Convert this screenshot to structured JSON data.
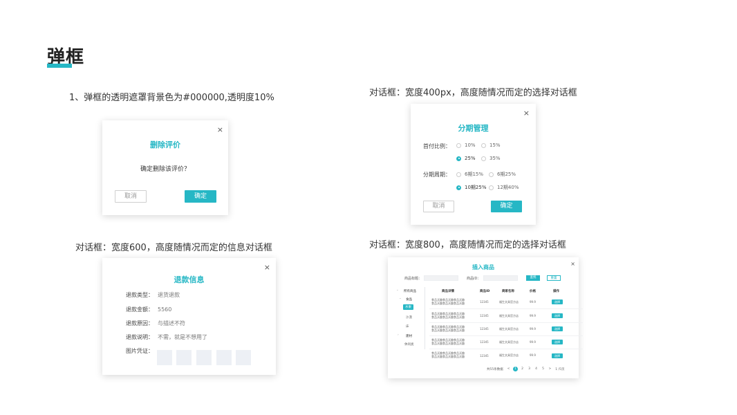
{
  "page": {
    "title": "弹框",
    "accent_color": "#26b7c5"
  },
  "captions": {
    "c1": "1、弹框的透明遮罩背景色为#000000,透明度10%",
    "c2": "对话框：宽度400px，高度随情况而定的选择对话框",
    "c3": "对话框：宽度600，高度随情况而定的信息对话框",
    "c4": "对话框：宽度800，高度随情况而定的选择对话框"
  },
  "dialog_delete": {
    "close": "×",
    "title": "删除评价",
    "message": "确定删除该评价？",
    "cancel": "取消",
    "confirm": "确定"
  },
  "dialog_installment": {
    "close": "×",
    "title": "分期管理",
    "down_payment_label": "首付比例：",
    "down_payment_options": [
      "10%",
      "15%",
      "25%",
      "35%"
    ],
    "down_payment_selected": "25%",
    "period_label": "分期周期：",
    "period_options": [
      "6期15%",
      "6期25%",
      "10期25%",
      "12期40%"
    ],
    "period_selected": "10期25%",
    "cancel": "取消",
    "confirm": "确定"
  },
  "dialog_refund": {
    "close": "×",
    "title": "退款信息",
    "rows": [
      {
        "label": "退款类型：",
        "value": "退货退款"
      },
      {
        "label": "退款金额：",
        "value": "5560"
      },
      {
        "label": "退款原因：",
        "value": "与描述不符"
      },
      {
        "label": "退款说明：",
        "value": "不需，就是不想用了"
      }
    ],
    "images_label": "图片凭证："
  },
  "dialog_insert": {
    "close": "×",
    "title": "插入商品",
    "name_label": "商品标题：",
    "id_label": "商品ID：",
    "search_btn": "查找",
    "reset_btn": "重置",
    "tree": {
      "header": "所有商品",
      "items": [
        "食品",
        "水果",
        "沙漠",
        "床",
        "建材",
        "休闲类"
      ]
    },
    "columns": [
      "商品详情",
      "商品ID",
      "商家名称",
      "价格",
      "操作"
    ],
    "rows": [
      {
        "detail1": "食品沃趣食品沃趣食品沃趣",
        "detail2": "食品沃趣食品沃趣食品沃趣",
        "id": "12345",
        "shop": "福生文具官方店",
        "price": "99.9",
        "action": "选择"
      },
      {
        "detail1": "食品沃趣食品沃趣食品沃趣",
        "detail2": "食品沃趣食品沃趣食品沃趣",
        "id": "12345",
        "shop": "福生文具官方店",
        "price": "99.9",
        "action": "选择"
      },
      {
        "detail1": "食品沃趣食品沃趣食品沃趣",
        "detail2": "食品沃趣食品沃趣食品沃趣",
        "id": "12345",
        "shop": "福生文具官方店",
        "price": "99.9",
        "action": "选择"
      },
      {
        "detail1": "食品沃趣食品沃趣食品沃趣",
        "detail2": "食品沃趣食品沃趣食品沃趣",
        "id": "12345",
        "shop": "福生文具官方店",
        "price": "99.9",
        "action": "选择"
      },
      {
        "detail1": "食品沃趣食品沃趣食品沃趣",
        "detail2": "食品沃趣食品沃趣食品沃趣",
        "id": "12345",
        "shop": "福生文具官方店",
        "price": "99.9",
        "action": "选择"
      }
    ],
    "pagination": {
      "total": "共55条数据",
      "prev": "<",
      "pages": [
        "1",
        "2",
        "3",
        "4",
        "5"
      ],
      "current": "1",
      "next": ">",
      "jump": "1 /5页"
    }
  }
}
